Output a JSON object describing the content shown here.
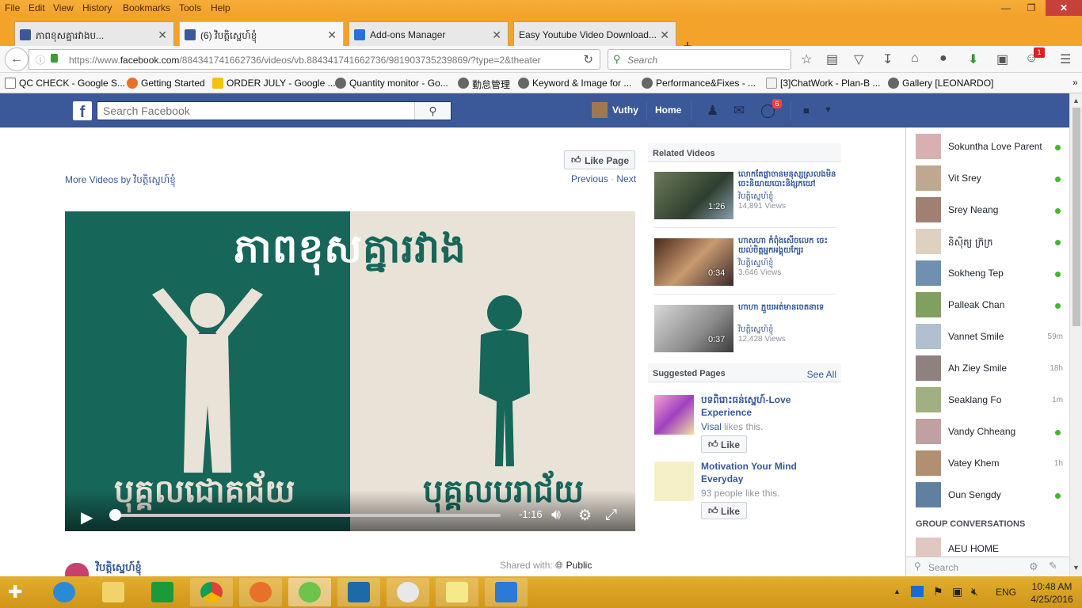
{
  "browser": {
    "menu": [
      "File",
      "Edit",
      "View",
      "History",
      "Bookmarks",
      "Tools",
      "Help"
    ],
    "tabs": [
      {
        "label": "ភាពខុសគ្នារវាងប...",
        "active": false
      },
      {
        "label": "(6) វិបត្តិស្នេហ៍ខ្ញុំ",
        "active": true
      },
      {
        "label": "Add-ons Manager",
        "active": false
      },
      {
        "label": "Easy Youtube Video Download...",
        "active": false
      }
    ],
    "new_tab": "+",
    "url_prefix": "https://www.",
    "url_domain": "facebook.com",
    "url_rest": "/884341741662736/videos/vb.884341741662736/981903735239869/?type=2&theater",
    "search_placeholder": "Search",
    "notif_badge": "1",
    "bookmarks": [
      "QC CHECK - Google S...",
      "Getting Started",
      "ORDER JULY - Google ...",
      "Quantity monitor - Go...",
      "勤怠管理",
      "Keyword & Image for ...",
      "Performance&Fixes - ...",
      "[3]ChatWork - Plan-B ...",
      "Gallery [LEONARDO]"
    ],
    "overflow": "»"
  },
  "facebook": {
    "search_placeholder": "Search Facebook",
    "user_name": "Vuthy",
    "home_label": "Home",
    "notif_count": "6"
  },
  "video": {
    "like_page_label": "Like Page",
    "more_videos_prefix": "More Videos by ",
    "page_name": "វិបត្តិស្នេហ៍ខ្ញុំ",
    "previous": "Previous",
    "separator": "·",
    "next": "Next",
    "title_part1": "ភាពខុស",
    "title_part2": "គ្នារវាង",
    "label_left": "បុគ្គលជោគជ័យ",
    "label_right": "បុគ្គលបរាជ័យ",
    "time_remaining": "-1:16",
    "progress_fraction": 0.0,
    "shared_with_label": "Shared with:",
    "privacy": "Public",
    "poster_name": "វិបត្តិស្នេហ៍ខ្ញុំ"
  },
  "related": {
    "heading": "Related Videos",
    "items": [
      {
        "title": "លោកតែផ្លាចានមនុស្សស្រលងមិន ចេះនិយាយបោះនិង្សកយៅ",
        "page": "វិបត្តិស្នេហ៍ខ្ញុំ",
        "views": "14,891 Views",
        "duration": "1:26"
      },
      {
        "title": "ហាសហា កំពុំងសើចលេក ចេះយល់ចិត្តអ្នកអង្គុយក្បែរ",
        "page": "វិបត្តិស្នេហ៍ខ្ញុំ",
        "views": "3,646 Views",
        "duration": "0:34"
      },
      {
        "title": "ហាហា ក្មួយអត់មានចេតនាទេ",
        "page": "វិបត្តិស្នេហ៍ខ្ញុំ",
        "views": "12,428 Views",
        "duration": "0:37"
      }
    ]
  },
  "suggested": {
    "heading": "Suggested Pages",
    "see_all": "See All",
    "like_label": "Like",
    "items": [
      {
        "name": "បទពិរោះធន់ស្នេហ៍-Love Experience",
        "likes_name": "Visal",
        "likes_suffix": " likes this."
      },
      {
        "name": "Motivation Your Mind Everyday",
        "likes_name": "",
        "likes_suffix": "93 people like this."
      }
    ]
  },
  "chat": {
    "friends": [
      {
        "name": "Sokuntha Love Parent",
        "status": "online",
        "ago": ""
      },
      {
        "name": "Vit Srey",
        "status": "online",
        "ago": ""
      },
      {
        "name": "Srey Neang",
        "status": "online",
        "ago": ""
      },
      {
        "name": "និស៊ិត្យ ក្រ៊ក្រ",
        "status": "online",
        "ago": ""
      },
      {
        "name": "Sokheng Tep",
        "status": "online",
        "ago": ""
      },
      {
        "name": "Palleak Chan",
        "status": "online",
        "ago": ""
      },
      {
        "name": "Vannet Smile",
        "status": "idle",
        "ago": "59m"
      },
      {
        "name": "Ah Ziey Smile",
        "status": "idle",
        "ago": "18h"
      },
      {
        "name": "Seaklang Fo",
        "status": "idle",
        "ago": "1m"
      },
      {
        "name": "Vandy Chheang",
        "status": "online",
        "ago": ""
      },
      {
        "name": "Vatey Khem",
        "status": "idle",
        "ago": "1h"
      },
      {
        "name": "Oun Sengdy",
        "status": "online",
        "ago": ""
      }
    ],
    "group_heading": "GROUP CONVERSATIONS",
    "group_name": "AEU HOME",
    "search_placeholder": "Search"
  },
  "taskbar": {
    "language": "ENG",
    "time": "10:48 AM",
    "date": "4/25/2016"
  },
  "colors": {
    "fb_blue": "#3b5998",
    "link": "#365899",
    "online": "#42b72a",
    "video_green": "#17665a",
    "titlebar_orange": "#f3a22a"
  }
}
